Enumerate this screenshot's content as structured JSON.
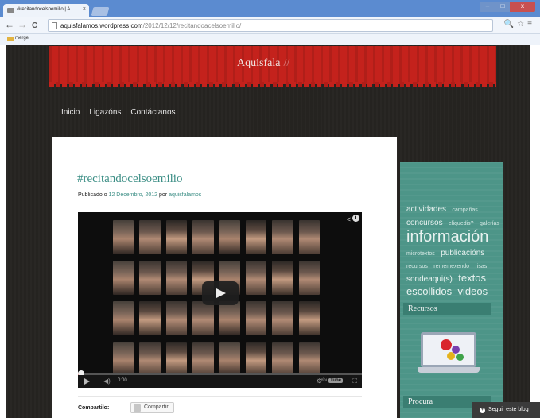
{
  "browser": {
    "tab_title": "#recitandocelsoemilio | A",
    "tab_close": "×",
    "url_domain": "aquisfalamos.wordpress.com",
    "url_path": "/2012/12/12/recitandoacelsoemilio/",
    "back": "←",
    "forward": "→",
    "reload": "C",
    "bookmark_folder": "merge",
    "window_min": "–",
    "window_max": "□",
    "window_close": "x",
    "tool_icons": "🔍☆≡"
  },
  "site": {
    "title": "Aquisfala",
    "title_suffix": "//"
  },
  "nav": {
    "items": [
      "Inicio",
      "Ligazóns",
      "Contáctanos"
    ]
  },
  "post": {
    "title": "#recitandocelsoemilio",
    "meta_prefix": "Publicado o",
    "date": "12 Decembro, 2012",
    "meta_by": "por",
    "author": "aquisfalamos",
    "video_time": "0:00",
    "video_brand": "You",
    "video_brand_box": "Tube",
    "video_progress": 0.01,
    "share_label": "Compartilo:",
    "share_button": "Compartir"
  },
  "sidebar": {
    "tags": [
      {
        "text": "actividades",
        "size": "m"
      },
      {
        "text": "campañas",
        "size": "s"
      },
      {
        "text": "concursos",
        "size": "m"
      },
      {
        "text": "eliquedis?",
        "size": "s"
      },
      {
        "text": "galerías",
        "size": "s"
      },
      {
        "text": "información",
        "size": "xl"
      },
      {
        "text": "microtextos",
        "size": "s"
      },
      {
        "text": "publicacións",
        "size": "m"
      },
      {
        "text": "recursos",
        "size": "s"
      },
      {
        "text": "rememexendo",
        "size": "s"
      },
      {
        "text": "risas",
        "size": "s"
      },
      {
        "text": "sondeaqui(s)",
        "size": "m"
      },
      {
        "text": "textos",
        "size": "l"
      },
      {
        "text": "escollidos",
        "size": "l"
      },
      {
        "text": "videos",
        "size": "l"
      }
    ],
    "recursos_title": "Recursos",
    "procura_title": "Procura"
  },
  "follow_button": "Seguir este blog"
}
